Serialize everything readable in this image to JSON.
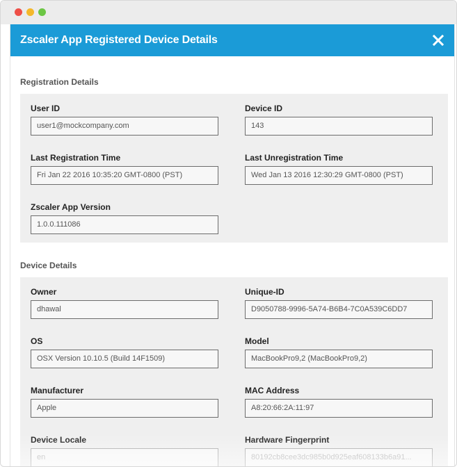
{
  "modal": {
    "title": "Zscaler App Registered Device Details",
    "close_icon": "close-icon"
  },
  "registration": {
    "title": "Registration Details",
    "user_id": {
      "label": "User ID",
      "value": "user1@mockcompany.com"
    },
    "device_id": {
      "label": "Device ID",
      "value": "143"
    },
    "last_registration": {
      "label": "Last Registration Time",
      "value": "Fri Jan 22 2016 10:35:20 GMT-0800 (PST)"
    },
    "last_unregistration": {
      "label": "Last Unregistration Time",
      "value": "Wed Jan 13 2016 12:30:29 GMT-0800 (PST)"
    },
    "app_version": {
      "label": "Zscaler App Version",
      "value": "1.0.0.111086"
    }
  },
  "device": {
    "title": "Device Details",
    "owner": {
      "label": "Owner",
      "value": "dhawal"
    },
    "unique_id": {
      "label": "Unique-ID",
      "value": "D9050788-9996-5A74-B6B4-7C0A539C6DD7"
    },
    "os": {
      "label": "OS",
      "value": "OSX Version 10.10.5 (Build 14F1509)"
    },
    "model": {
      "label": "Model",
      "value": "MacBookPro9,2 (MacBookPro9,2)"
    },
    "manufacturer": {
      "label": "Manufacturer",
      "value": "Apple"
    },
    "mac_address": {
      "label": "MAC Address",
      "value": "A8:20:66:2A:11:97"
    },
    "locale": {
      "label": "Device Locale",
      "value": "en"
    },
    "hw_fingerprint": {
      "label": "Hardware Fingerprint",
      "value": "80192cb8cee3dc985b0d925eaf608133b6a91..."
    }
  },
  "colors": {
    "header": "#1b9bd7",
    "panel": "#efefef",
    "traffic_red": "#ee4f47",
    "traffic_yellow": "#f4b82b",
    "traffic_green": "#6cc644"
  }
}
